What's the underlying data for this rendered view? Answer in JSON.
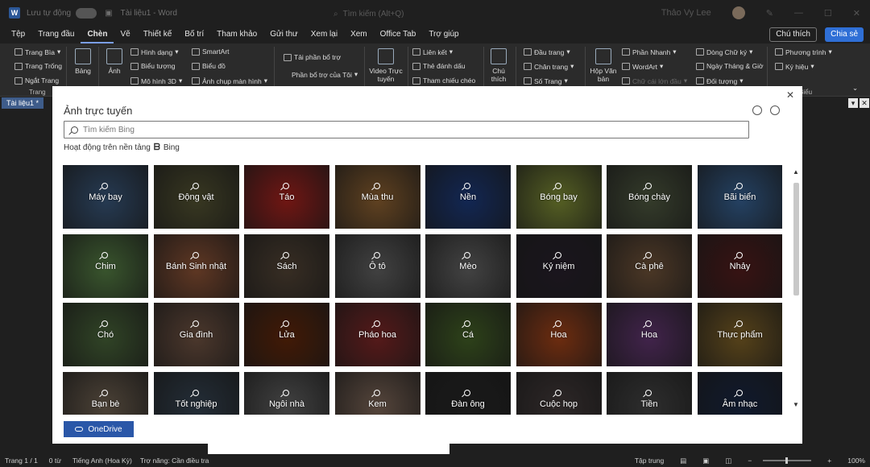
{
  "titlebar": {
    "autosave_label": "Lưu tự động",
    "doc_name": "Tài liệu1 - Word",
    "search_placeholder": "Tìm kiếm (Alt+Q)",
    "user_name": "Thảo Vy Lee"
  },
  "menu": {
    "items": [
      "Tệp",
      "Trang đầu",
      "Chèn",
      "Vẽ",
      "Thiết kế",
      "Bố trí",
      "Tham khảo",
      "Gửi thư",
      "Xem lại",
      "Xem",
      "Office Tab",
      "Trợ giúp"
    ],
    "active": "Chèn",
    "comment_label": "Chú thích",
    "share_label": "Chia sẻ"
  },
  "ribbon": {
    "pages": {
      "cover": "Trang Bìa",
      "blank": "Trang Trống",
      "break": "Ngắt Trang",
      "group": "Trang"
    },
    "table": "Bảng",
    "picture": "Ảnh",
    "illus": {
      "shapes": "Hình dạng",
      "icons": "Biểu tượng",
      "models": "Mô hình 3D",
      "smartart": "SmartArt",
      "chart": "Biểu đồ",
      "screenshot": "Ảnh chụp màn hình"
    },
    "addins": {
      "get": "Tải phần bổ trợ",
      "mine": "Phần bổ trợ của Tôi"
    },
    "video": "Video Trực tuyến",
    "links": {
      "link": "Liên kết",
      "bookmark": "Thẻ đánh dấu",
      "crossref": "Tham chiếu chéo"
    },
    "comment": "Chú thích",
    "header_footer": {
      "header": "Đầu trang",
      "footer": "Chân trang",
      "page_number": "Số Trang"
    },
    "textbox": "Hộp Văn bản",
    "text": {
      "quickparts": "Phần Nhanh",
      "wordart": "WordArt",
      "dropcap": "Chữ cái lớn đầu",
      "signature": "Dòng Chữ ký",
      "datetime": "Ngày Tháng & Giờ",
      "object": "Đối tượng"
    },
    "symbols": {
      "equation": "Phương trình",
      "symbol": "Ký hiệu",
      "group": "Biểu"
    }
  },
  "docbar": {
    "tab": "Tài liệu1 *"
  },
  "dialog": {
    "title": "Ảnh trực tuyến",
    "search_placeholder": "Tìm kiếm Bing",
    "powered_label": "Hoạt động trên nền tảng",
    "bing_label": "Bing",
    "onedrive_label": "OneDrive",
    "tiles": [
      {
        "label": "Máy bay",
        "color": "#3e5f86"
      },
      {
        "label": "Động vật",
        "color": "#5b5a36"
      },
      {
        "label": "Táo",
        "color": "#b52420"
      },
      {
        "label": "Mùa thu",
        "color": "#9b6a35"
      },
      {
        "label": "Nền",
        "color": "#1e3f86"
      },
      {
        "label": "Bóng bay",
        "color": "#8a9a3a"
      },
      {
        "label": "Bóng chày",
        "color": "#556045"
      },
      {
        "label": "Bãi biển",
        "color": "#3b6aa0"
      },
      {
        "label": "Chim",
        "color": "#5d8a4a"
      },
      {
        "label": "Bánh Sinh nhật",
        "color": "#9a5a3a"
      },
      {
        "label": "Sách",
        "color": "#5a4a3a"
      },
      {
        "label": "Ô tô",
        "color": "#6a6a6a"
      },
      {
        "label": "Mèo",
        "color": "#6c6c6c"
      },
      {
        "label": "Kỷ niệm",
        "color": "#2b2230"
      },
      {
        "label": "Cà phê",
        "color": "#7a5a3e"
      },
      {
        "label": "Nhảy",
        "color": "#5a1f1f"
      },
      {
        "label": "Chó",
        "color": "#4f6e3e"
      },
      {
        "label": "Gia đình",
        "color": "#7a5a48"
      },
      {
        "label": "Lửa",
        "color": "#6a2a0a"
      },
      {
        "label": "Pháo hoa",
        "color": "#8a2a2a"
      },
      {
        "label": "Cá",
        "color": "#4a6a2a"
      },
      {
        "label": "Hoa",
        "color": "#b0481a"
      },
      {
        "label": "Hoa",
        "color": "#6a3a7a"
      },
      {
        "label": "Thực phẩm",
        "color": "#8a6a2a"
      },
      {
        "label": "Bạn bè",
        "color": "#7a6a58"
      },
      {
        "label": "Tốt nghiệp",
        "color": "#3a4a5a"
      },
      {
        "label": "Ngôi nhà",
        "color": "#6a6a6a"
      },
      {
        "label": "Kem",
        "color": "#8a7060"
      },
      {
        "label": "Đàn ông",
        "color": "#2a2a2a"
      },
      {
        "label": "Cuộc họp",
        "color": "#4a4040"
      },
      {
        "label": "Tiền",
        "color": "#4a4a4a"
      },
      {
        "label": "Âm nhạc",
        "color": "#1a2a4a"
      }
    ]
  },
  "statusbar": {
    "page": "Trang 1 / 1",
    "words": "0 từ",
    "language": "Tiếng Anh (Hoa Kỳ)",
    "accessibility": "Trợ năng: Cần điều tra",
    "focus": "Tập trung",
    "zoom": "100%"
  }
}
